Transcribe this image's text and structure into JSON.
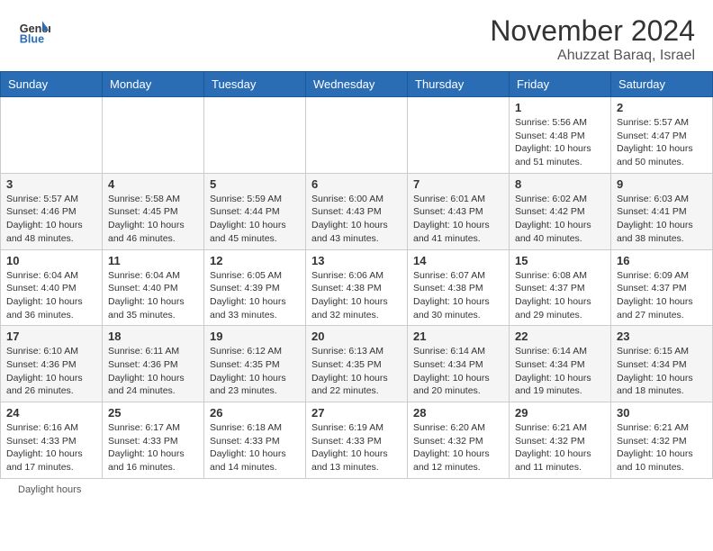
{
  "header": {
    "logo_text_general": "General",
    "logo_text_blue": "Blue",
    "month_title": "November 2024",
    "location": "Ahuzzat Baraq, Israel"
  },
  "days_of_week": [
    "Sunday",
    "Monday",
    "Tuesday",
    "Wednesday",
    "Thursday",
    "Friday",
    "Saturday"
  ],
  "weeks": [
    [
      null,
      null,
      null,
      null,
      null,
      {
        "day": "1",
        "sunrise": "5:56 AM",
        "sunset": "4:48 PM",
        "daylight": "10 hours and 51 minutes."
      },
      {
        "day": "2",
        "sunrise": "5:57 AM",
        "sunset": "4:47 PM",
        "daylight": "10 hours and 50 minutes."
      }
    ],
    [
      {
        "day": "3",
        "sunrise": "5:57 AM",
        "sunset": "4:46 PM",
        "daylight": "10 hours and 48 minutes."
      },
      {
        "day": "4",
        "sunrise": "5:58 AM",
        "sunset": "4:45 PM",
        "daylight": "10 hours and 46 minutes."
      },
      {
        "day": "5",
        "sunrise": "5:59 AM",
        "sunset": "4:44 PM",
        "daylight": "10 hours and 45 minutes."
      },
      {
        "day": "6",
        "sunrise": "6:00 AM",
        "sunset": "4:43 PM",
        "daylight": "10 hours and 43 minutes."
      },
      {
        "day": "7",
        "sunrise": "6:01 AM",
        "sunset": "4:43 PM",
        "daylight": "10 hours and 41 minutes."
      },
      {
        "day": "8",
        "sunrise": "6:02 AM",
        "sunset": "4:42 PM",
        "daylight": "10 hours and 40 minutes."
      },
      {
        "day": "9",
        "sunrise": "6:03 AM",
        "sunset": "4:41 PM",
        "daylight": "10 hours and 38 minutes."
      }
    ],
    [
      {
        "day": "10",
        "sunrise": "6:04 AM",
        "sunset": "4:40 PM",
        "daylight": "10 hours and 36 minutes."
      },
      {
        "day": "11",
        "sunrise": "6:04 AM",
        "sunset": "4:40 PM",
        "daylight": "10 hours and 35 minutes."
      },
      {
        "day": "12",
        "sunrise": "6:05 AM",
        "sunset": "4:39 PM",
        "daylight": "10 hours and 33 minutes."
      },
      {
        "day": "13",
        "sunrise": "6:06 AM",
        "sunset": "4:38 PM",
        "daylight": "10 hours and 32 minutes."
      },
      {
        "day": "14",
        "sunrise": "6:07 AM",
        "sunset": "4:38 PM",
        "daylight": "10 hours and 30 minutes."
      },
      {
        "day": "15",
        "sunrise": "6:08 AM",
        "sunset": "4:37 PM",
        "daylight": "10 hours and 29 minutes."
      },
      {
        "day": "16",
        "sunrise": "6:09 AM",
        "sunset": "4:37 PM",
        "daylight": "10 hours and 27 minutes."
      }
    ],
    [
      {
        "day": "17",
        "sunrise": "6:10 AM",
        "sunset": "4:36 PM",
        "daylight": "10 hours and 26 minutes."
      },
      {
        "day": "18",
        "sunrise": "6:11 AM",
        "sunset": "4:36 PM",
        "daylight": "10 hours and 24 minutes."
      },
      {
        "day": "19",
        "sunrise": "6:12 AM",
        "sunset": "4:35 PM",
        "daylight": "10 hours and 23 minutes."
      },
      {
        "day": "20",
        "sunrise": "6:13 AM",
        "sunset": "4:35 PM",
        "daylight": "10 hours and 22 minutes."
      },
      {
        "day": "21",
        "sunrise": "6:14 AM",
        "sunset": "4:34 PM",
        "daylight": "10 hours and 20 minutes."
      },
      {
        "day": "22",
        "sunrise": "6:14 AM",
        "sunset": "4:34 PM",
        "daylight": "10 hours and 19 minutes."
      },
      {
        "day": "23",
        "sunrise": "6:15 AM",
        "sunset": "4:34 PM",
        "daylight": "10 hours and 18 minutes."
      }
    ],
    [
      {
        "day": "24",
        "sunrise": "6:16 AM",
        "sunset": "4:33 PM",
        "daylight": "10 hours and 17 minutes."
      },
      {
        "day": "25",
        "sunrise": "6:17 AM",
        "sunset": "4:33 PM",
        "daylight": "10 hours and 16 minutes."
      },
      {
        "day": "26",
        "sunrise": "6:18 AM",
        "sunset": "4:33 PM",
        "daylight": "10 hours and 14 minutes."
      },
      {
        "day": "27",
        "sunrise": "6:19 AM",
        "sunset": "4:33 PM",
        "daylight": "10 hours and 13 minutes."
      },
      {
        "day": "28",
        "sunrise": "6:20 AM",
        "sunset": "4:32 PM",
        "daylight": "10 hours and 12 minutes."
      },
      {
        "day": "29",
        "sunrise": "6:21 AM",
        "sunset": "4:32 PM",
        "daylight": "10 hours and 11 minutes."
      },
      {
        "day": "30",
        "sunrise": "6:21 AM",
        "sunset": "4:32 PM",
        "daylight": "10 hours and 10 minutes."
      }
    ]
  ],
  "footer": {
    "note": "Daylight hours"
  }
}
